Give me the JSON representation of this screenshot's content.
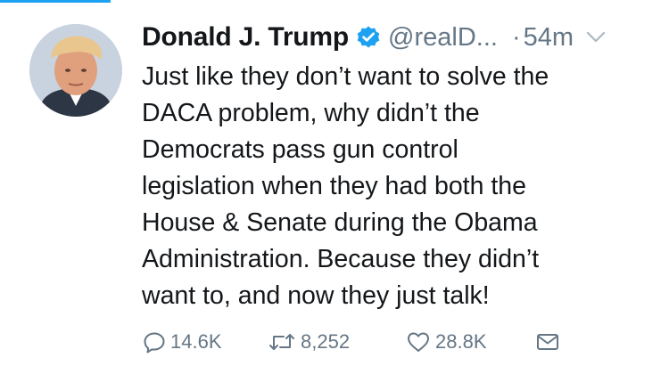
{
  "tweet": {
    "author": {
      "name": "Donald J. Trump",
      "handle": "@realD...",
      "verified": true
    },
    "separator": "·",
    "time": "54m",
    "text": "Just like they don’t want to solve the\nDACA problem, why didn’t the\nDemocrats pass gun control\nlegislation when they had both the\nHouse & Senate during the Obama\nAdministration. Because they didn’t\nwant to, and now they just talk!",
    "counts": {
      "replies": "14.6K",
      "retweets": "8,252",
      "likes": "28.8K"
    },
    "icons": {
      "reply": "reply-icon",
      "retweet": "retweet-icon",
      "like": "heart-icon",
      "message": "envelope-icon",
      "menu": "chevron-down-icon",
      "verified": "verified-badge-icon"
    },
    "colors": {
      "text": "#14171a",
      "secondary": "#657786",
      "verified": "#1da1f2"
    }
  }
}
